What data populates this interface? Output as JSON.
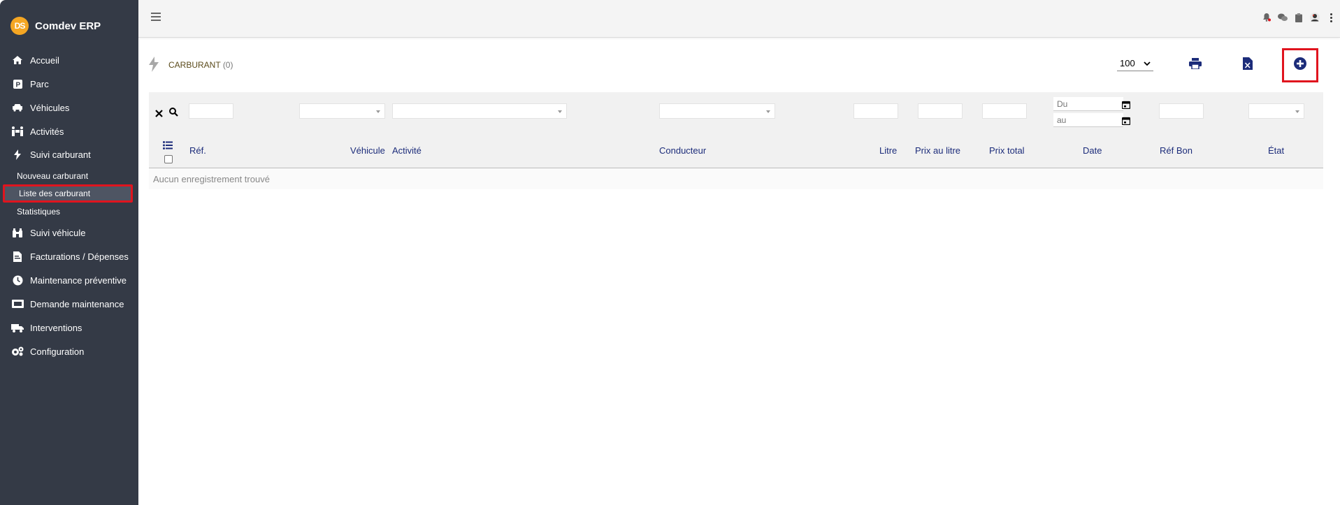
{
  "app": {
    "name": "Comdev ERP",
    "logo_text": "DS"
  },
  "sidebar": {
    "items": [
      {
        "label": "Accueil",
        "icon": "home-icon"
      },
      {
        "label": "Parc",
        "icon": "parking-icon"
      },
      {
        "label": "Véhicules",
        "icon": "car-icon"
      },
      {
        "label": "Activités",
        "icon": "people-carry-icon"
      },
      {
        "label": "Suivi carburant",
        "icon": "bolt-icon"
      },
      {
        "label": "Suivi véhicule",
        "icon": "binoculars-icon"
      },
      {
        "label": "Facturations / Dépenses",
        "icon": "invoice-icon"
      },
      {
        "label": "Maintenance préventive",
        "icon": "clock-icon"
      },
      {
        "label": "Demande maintenance",
        "icon": "ticket-icon"
      },
      {
        "label": "Interventions",
        "icon": "truck-icon"
      },
      {
        "label": "Configuration",
        "icon": "gears-icon"
      }
    ],
    "subitems": [
      {
        "label": "Nouveau carburant"
      },
      {
        "label": "Liste des carburant",
        "active": true
      },
      {
        "label": "Statistiques"
      }
    ]
  },
  "page": {
    "title": "CARBURANT",
    "count": "(0)",
    "per_page": "100"
  },
  "filters": {
    "date_from_placeholder": "Du",
    "date_to_placeholder": "au"
  },
  "table": {
    "columns": [
      "Réf.",
      "Véhicule",
      "Activité",
      "Conducteur",
      "Litre",
      "Prix au litre",
      "Prix total",
      "Date",
      "Réf Bon",
      "État"
    ],
    "empty_message": "Aucun enregistrement trouvé"
  },
  "colors": {
    "sidebar_bg": "#343a46",
    "accent": "#1c2c7a",
    "highlight": "#e0141e"
  }
}
